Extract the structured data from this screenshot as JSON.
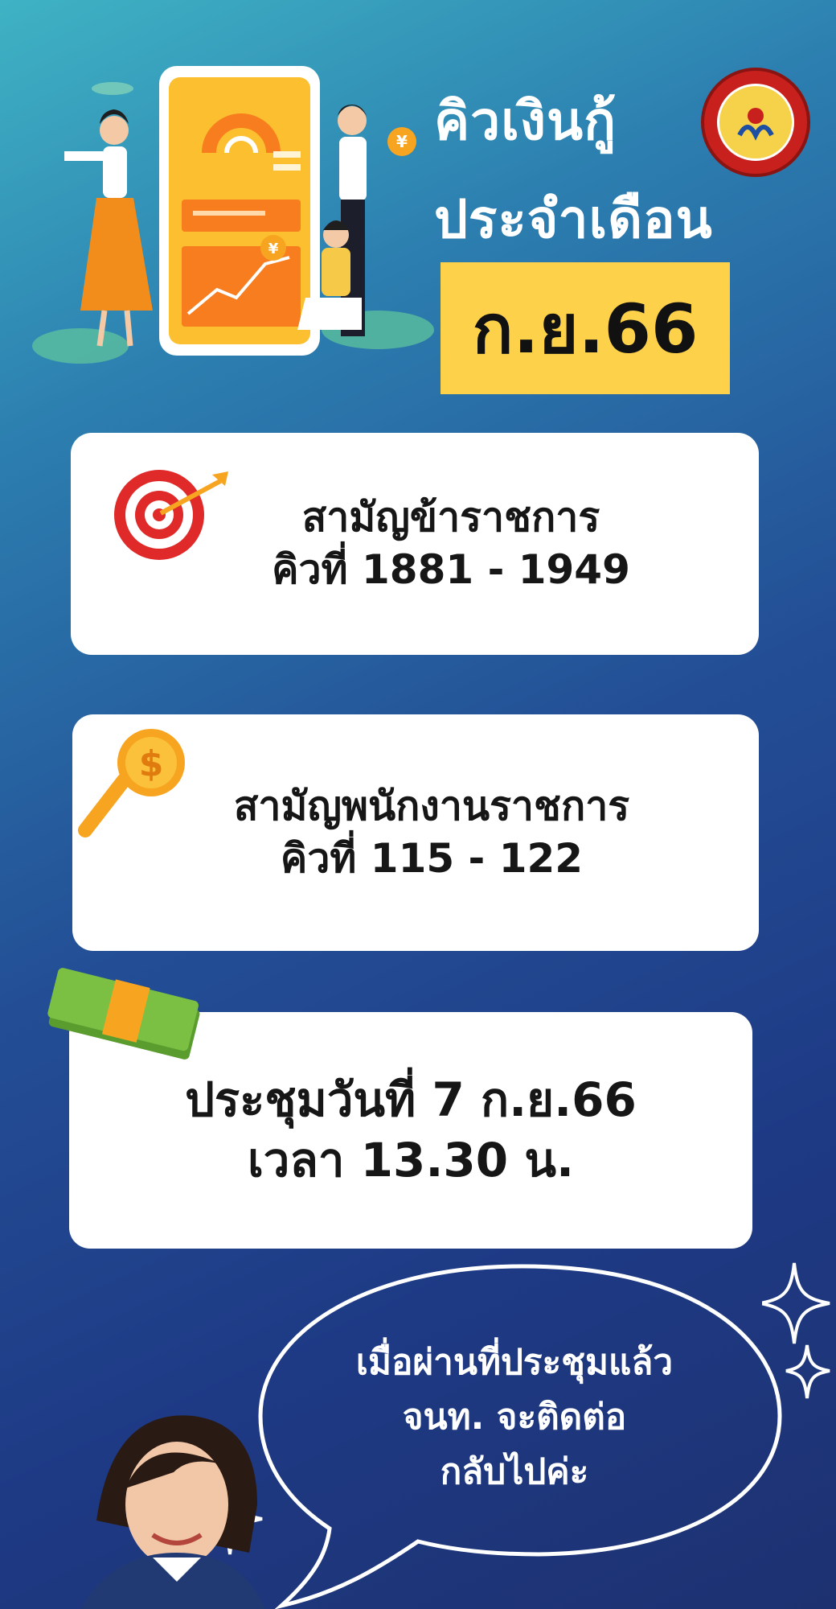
{
  "header": {
    "title_line1": "คิวเงินกู้",
    "title_line2": "ประจำเดือน",
    "month": "ก.ย.66"
  },
  "cards": [
    {
      "line1": "สามัญข้าราชการ",
      "line2": "คิวที่ 1881 - 1949",
      "icon": "target-icon"
    },
    {
      "line1": "สามัญพนักงานราชการ",
      "line2": "คิวที่ 115 - 122",
      "icon": "magnifier-coin-icon"
    },
    {
      "line1": "ประชุมวันที่ 7 ก.ย.66",
      "line2": "เวลา 13.30 น.",
      "icon": "money-stack-icon"
    }
  ],
  "bubble": {
    "line1": "เมื่อผ่านที่ประชุมแล้ว",
    "line2": "จนท. จะติดต่อ",
    "line3": "กลับไปค่ะ"
  },
  "colors": {
    "highlight": "#fdd24a",
    "card": "#ffffff",
    "text": "#161616",
    "target_red": "#e02a2a",
    "coin": "#f7a520",
    "money_green": "#7bc043"
  }
}
